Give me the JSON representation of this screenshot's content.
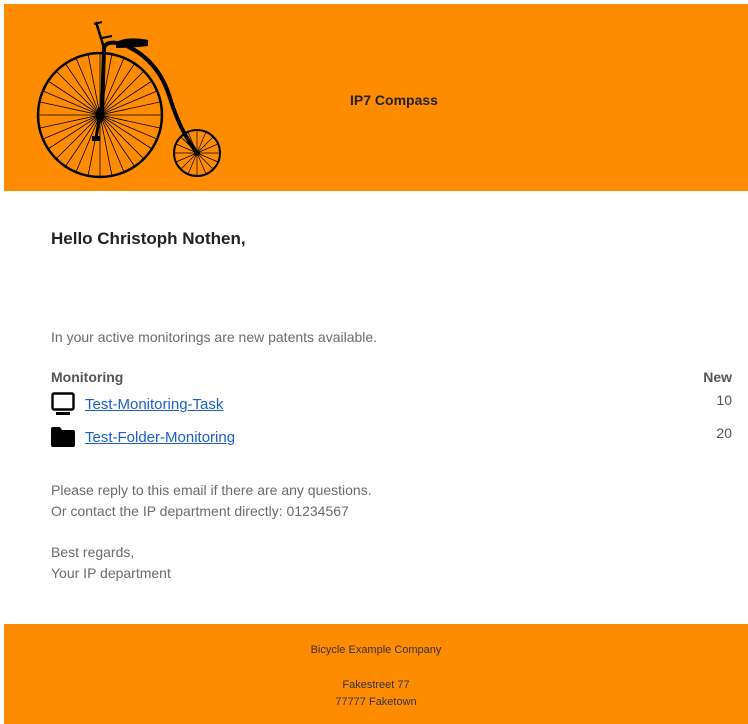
{
  "header": {
    "title": "IP7 Compass",
    "logo_icon": "penny-farthing-bicycle-icon"
  },
  "greeting": "Hello Christoph Nothen,",
  "intro": "In your active monitorings are new patents available.",
  "table": {
    "col_monitoring": "Monitoring",
    "col_new": "New",
    "rows": [
      {
        "icon": "monitor-icon",
        "label": "Test-Monitoring-Task",
        "count": "10"
      },
      {
        "icon": "folder-icon",
        "label": "Test-Folder-Monitoring",
        "count": "20"
      }
    ]
  },
  "contact": {
    "line1": "Please reply to this email if there are any questions.",
    "line2": "Or contact the IP department directly: 01234567"
  },
  "signoff": {
    "line1": "Best regards,",
    "line2": "Your IP department"
  },
  "footer": {
    "company": "Bicycle Example Company",
    "street": "Fakestreet 77",
    "city": "77777 Faketown"
  },
  "colors": {
    "brand_orange": "#ff8c00",
    "link_blue": "#1a5fcb"
  }
}
